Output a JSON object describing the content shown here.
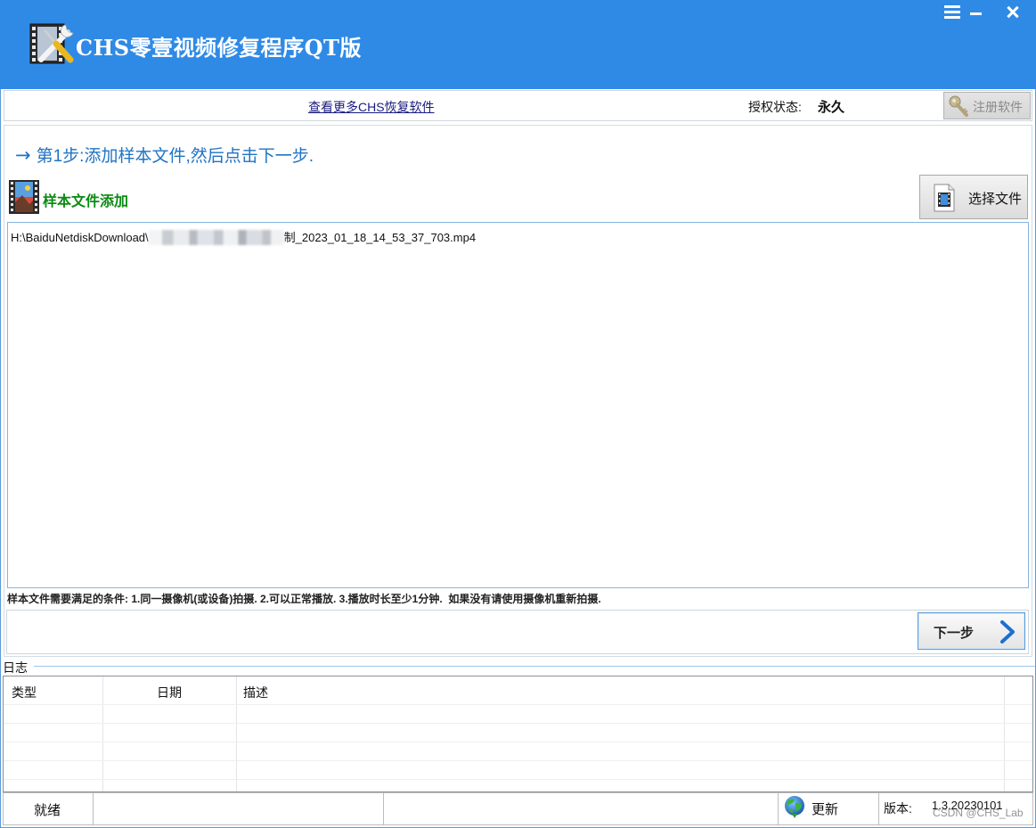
{
  "window": {
    "title": "CHS零壹视频修复程序QT版",
    "icons": [
      "app-logo-icon",
      "menu-icon",
      "minimize-icon",
      "close-icon"
    ]
  },
  "toolbar": {
    "more_link": "查看更多CHS恢复软件",
    "license_label": "授权状态:",
    "license_value": "永久",
    "register_button": "注册软件",
    "register_icon": "key-icon"
  },
  "step": {
    "arrow": "→",
    "text": "第1步:添加样本文件,然后点击下一步."
  },
  "sample": {
    "title": "样本文件添加",
    "title_icon": "film-icon",
    "select_button": "选择文件",
    "select_icon": "video-file-icon",
    "files": [
      {
        "path_start": "H:\\BaiduNetdiskDownload\\",
        "path_end": "制_2023_01_18_14_53_37_703.mp4"
      }
    ],
    "requirements": "样本文件需要满足的条件: 1.同一摄像机(或设备)拍摄. 2.可以正常播放. 3.播放时长至少1分钟.  如果没有请使用摄像机重新拍摄."
  },
  "next": {
    "label": "下一步",
    "icon": "chevron-right-icon"
  },
  "log": {
    "title": "日志",
    "columns": [
      "类型",
      "日期",
      "描述"
    ],
    "rows": []
  },
  "status": {
    "state": "就绪",
    "update_label": "更新",
    "update_icon": "globe-icon",
    "version_label": "版本:",
    "version": "1.3.20230101"
  },
  "watermark": "CSDN @CHS_Lab",
  "colors": {
    "titlebar": "#2f8ae6",
    "step_text": "#2173c4",
    "sample_title": "#0b8a12",
    "link": "#1a1a80",
    "next_chevron": "#1d6fd0"
  }
}
